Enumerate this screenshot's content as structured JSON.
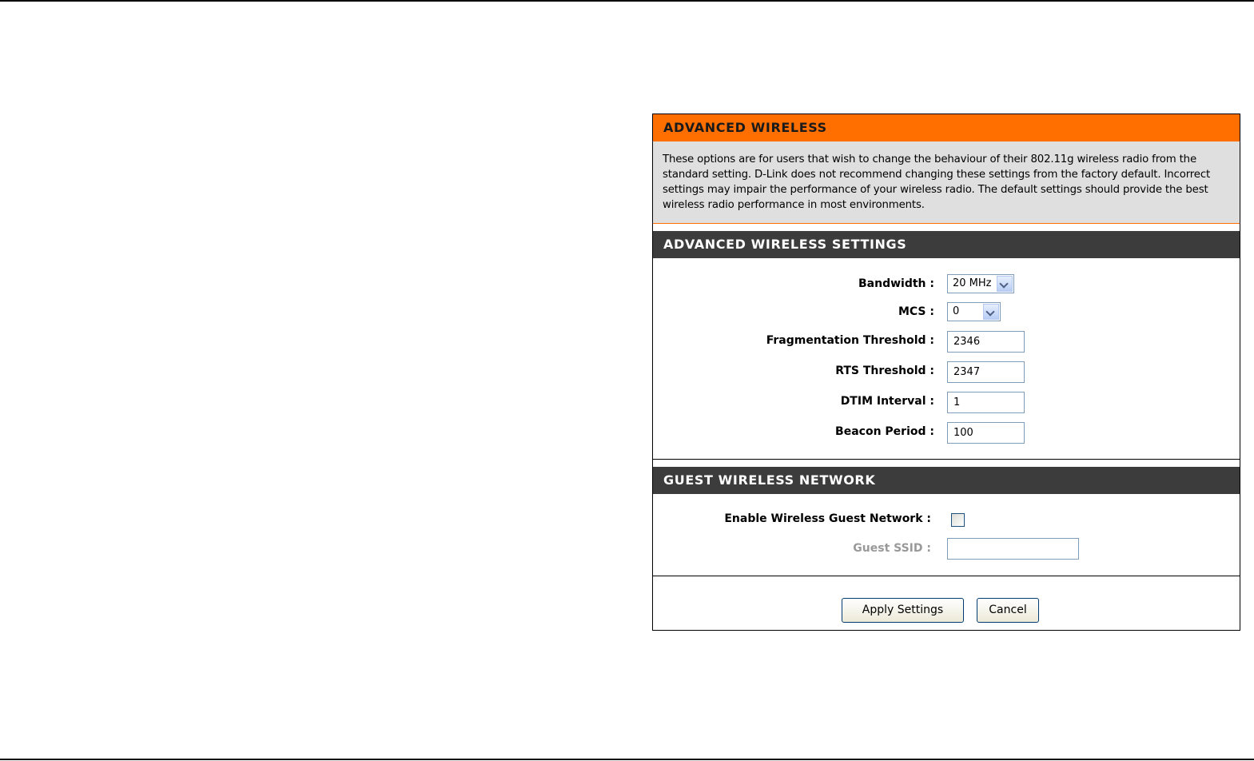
{
  "advanced_wireless": {
    "title": "ADVANCED WIRELESS",
    "intro_lines": [
      "These options are for users that wish to change the behaviour of their 802.11g wireless radio from the",
      "standard setting. D-Link does not recommend changing these settings from the factory default. Incorrect",
      "settings may impair the performance of your wireless radio. The default settings should provide the best",
      "wireless radio performance in most environments."
    ]
  },
  "settings": {
    "title": "ADVANCED WIRELESS SETTINGS",
    "bandwidth_label": "Bandwidth :",
    "bandwidth_value": "20 MHz",
    "mcs_label": "MCS :",
    "mcs_value": "0",
    "fragmentation_label": "Fragmentation Threshold :",
    "fragmentation_value": "2346",
    "rts_label": "RTS Threshold :",
    "rts_value": "2347",
    "dtim_label": "DTIM Interval :",
    "dtim_value": "1",
    "beacon_label": "Beacon Period :",
    "beacon_value": "100"
  },
  "guest": {
    "title": "GUEST WIRELESS NETWORK",
    "enable_label": "Enable Wireless Guest Network :",
    "enable_checked": false,
    "ssid_label": "Guest SSID :",
    "ssid_value": ""
  },
  "buttons": {
    "apply_label": "Apply Settings",
    "cancel_label": "Cancel"
  },
  "colors": {
    "orange_header": "#ff6f00",
    "dark_header": "#3c3c3c",
    "intro_background": "#dfdfdf"
  }
}
